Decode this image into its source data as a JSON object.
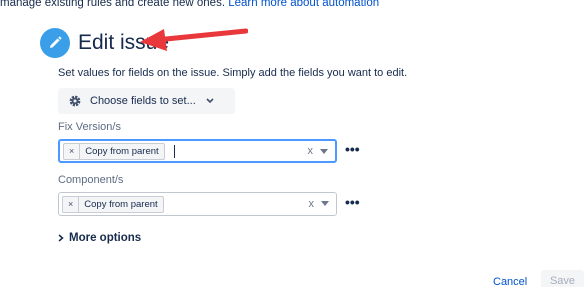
{
  "intro": {
    "text": "manage existing rules and create new ones.",
    "link": "Learn more about automation"
  },
  "header": {
    "title": "Edit issue"
  },
  "description": "Set values for fields on the issue. Simply add the fields you want to edit.",
  "choose_fields": {
    "label": "Choose fields to set..."
  },
  "fields": [
    {
      "label": "Fix Version/s",
      "chip": "Copy from parent",
      "chip_remove": "×",
      "clear": "x",
      "more": "•••"
    },
    {
      "label": "Component/s",
      "chip": "Copy from parent",
      "chip_remove": "×",
      "clear": "x",
      "more": "•••"
    }
  ],
  "more_options": "More options",
  "footer": {
    "cancel": "Cancel",
    "save": "Save"
  },
  "colors": {
    "accent": "#3b9ee8",
    "link": "#0052cc",
    "annotation_arrow": "#e8383b",
    "focus_border": "#4c9aff"
  },
  "icons": {
    "header": "pencil-icon",
    "choose": "gear-icon",
    "annotation": "red-arrow-icon"
  }
}
